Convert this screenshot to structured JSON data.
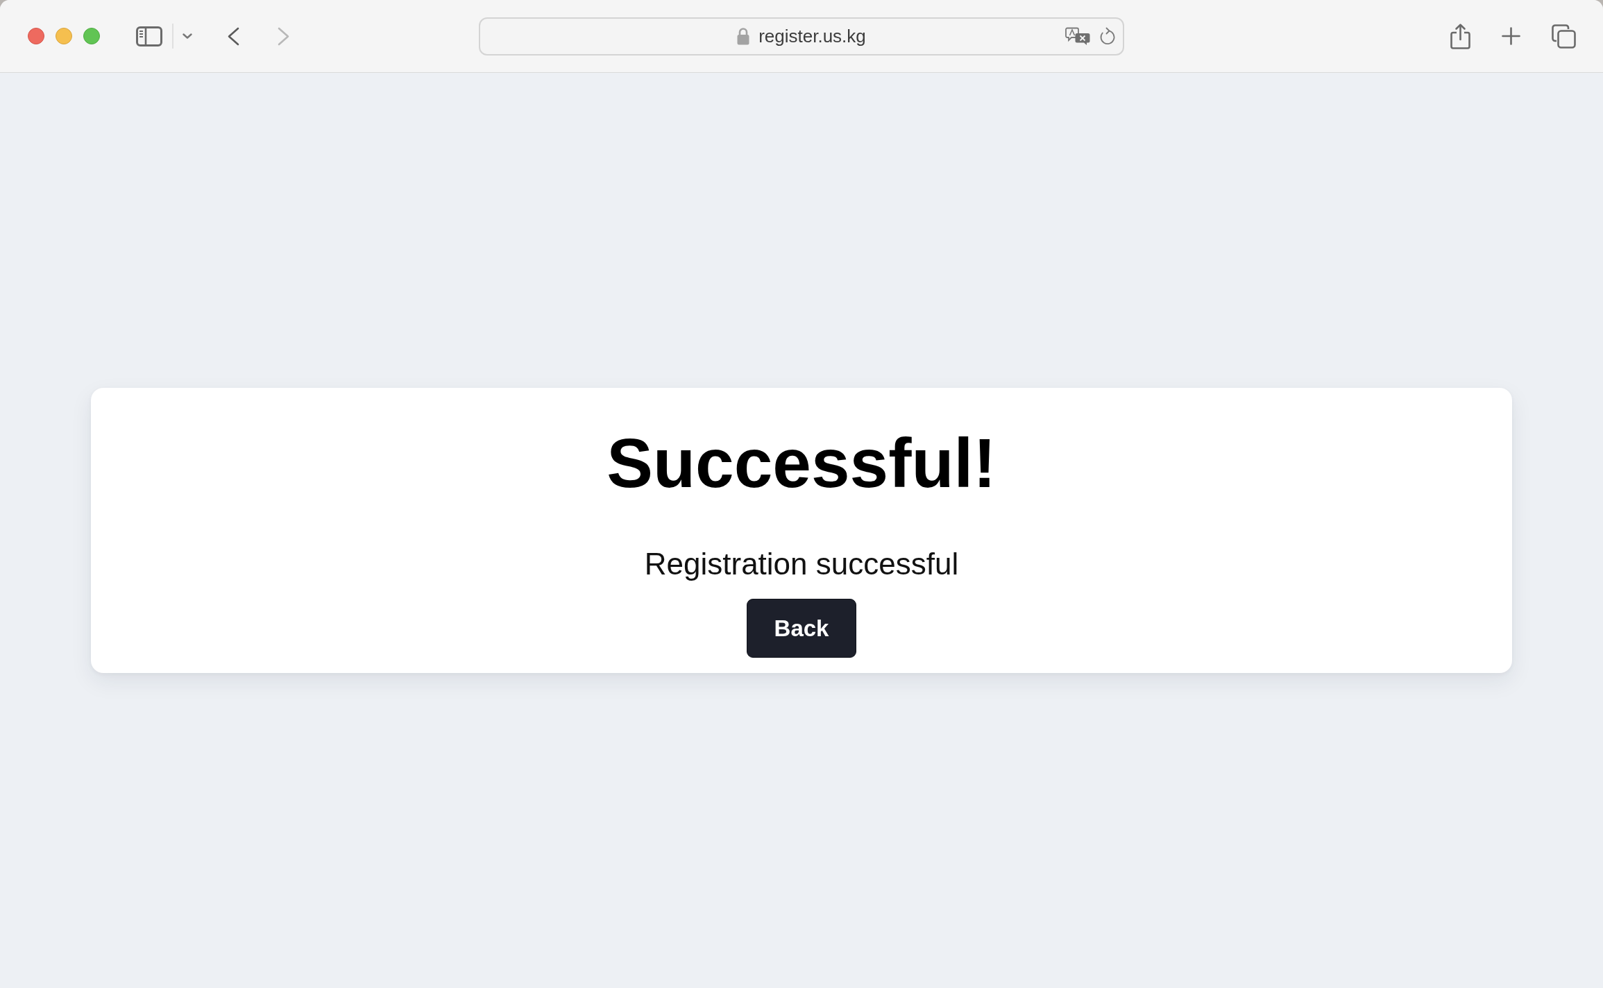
{
  "toolbar": {
    "back": {
      "disabled": false
    },
    "forward": {
      "disabled": true
    }
  },
  "address_bar": {
    "url": "register.us.kg",
    "secure": true
  },
  "card": {
    "title": "Successful!",
    "message": "Registration successful",
    "button": "Back"
  }
}
